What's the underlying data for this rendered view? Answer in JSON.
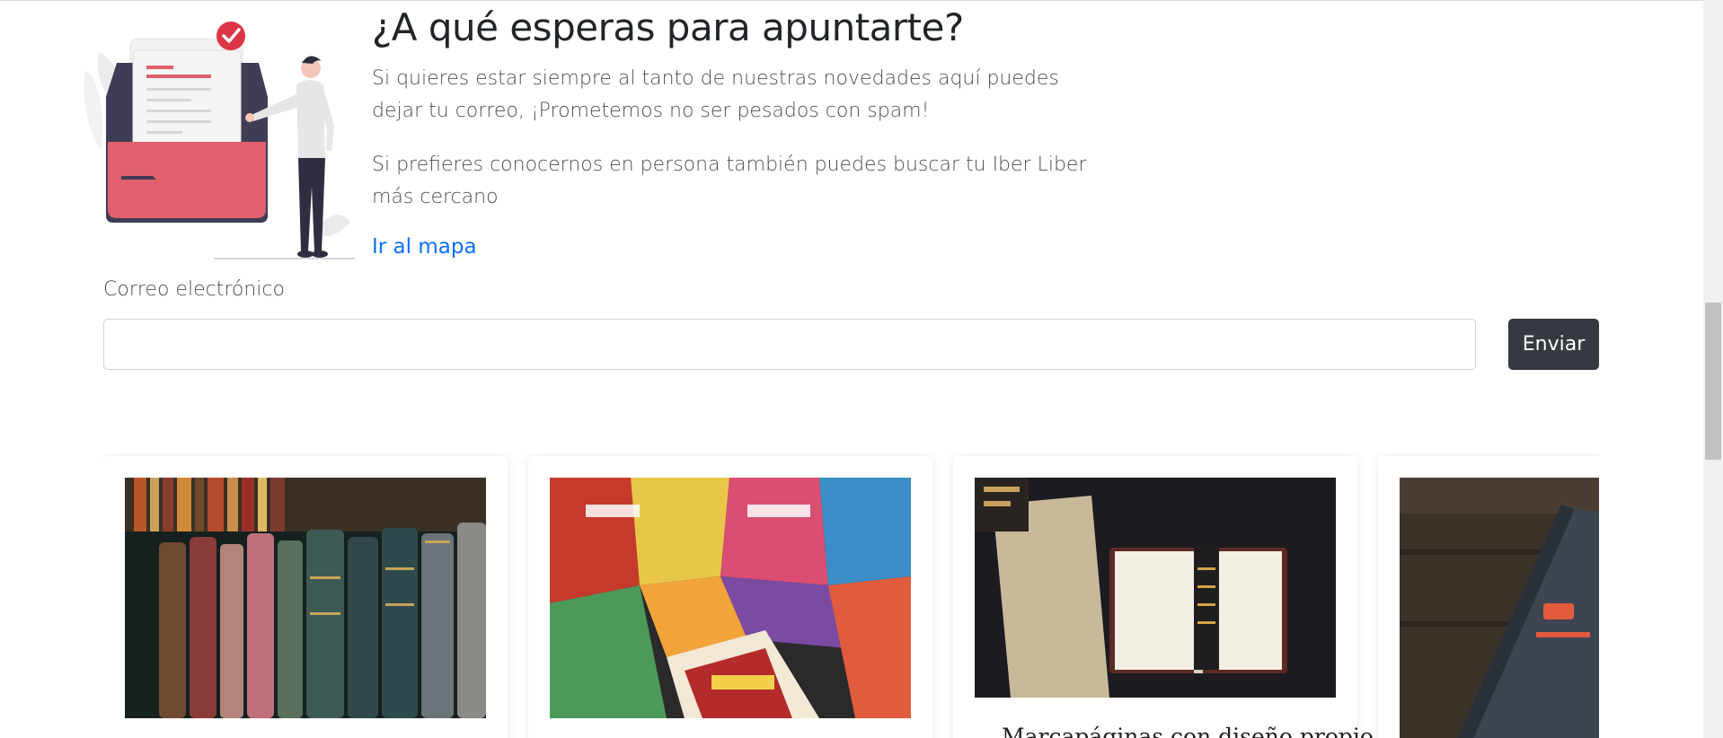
{
  "newsletter": {
    "heading": "¿A qué esperas para apuntarte?",
    "paragraph_1": "Si quieres estar siempre al tanto de nuestras novedades aquí puedes dejar tu correo, ¡Prometemos no ser pesados con spam!",
    "paragraph_2": "Si prefieres conocernos en persona también puedes buscar tu Iber Liber más cercano",
    "map_link": "Ir al mapa",
    "email_label": "Correo electrónico",
    "email_value": "",
    "send_label": "Enviar"
  },
  "cards": [
    {
      "title": "",
      "image": "old-books-shelf"
    },
    {
      "title": "",
      "image": "comic-books-pile"
    },
    {
      "title": "Marcapáginas con diseño propio",
      "image": "open-bible-bookmark"
    },
    {
      "title": "",
      "image": "notebook-write-it"
    }
  ],
  "colors": {
    "accent_red": "#dc3545",
    "illustration_red": "#e0606e",
    "illustration_dark": "#3f3d56",
    "button_dark": "#343a40",
    "link_blue": "#0d6efd"
  }
}
